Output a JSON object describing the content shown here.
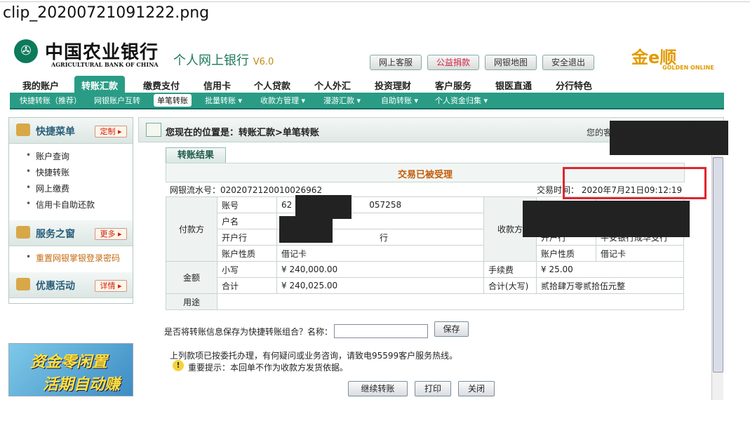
{
  "filename": "clip_20200721091222.png",
  "brand": {
    "bank_cn": "中国农业银行",
    "bank_en": "AGRICULTURAL BANK OF CHINA",
    "product": "个人网上银行",
    "version": "V6.0",
    "golden_cn": "金e顺",
    "golden_en": "GOLDEN ONLINE"
  },
  "top_buttons": [
    "网上客服",
    "公益捐款",
    "网银地图",
    "安全退出"
  ],
  "nav": [
    "我的账户",
    "转账汇款",
    "缴费支付",
    "信用卡",
    "个人贷款",
    "个人外汇",
    "投资理财",
    "客户服务",
    "银医直通",
    "分行特色"
  ],
  "subnav": [
    "快捷转账（推荐）",
    "网银账户互转",
    "单笔转账",
    "批量转账 ▾",
    "收款方管理 ▾",
    "漫游汇款 ▾",
    "自助转账 ▾",
    "个人资金归集 ▾"
  ],
  "sidebar": {
    "quick_title": "快捷菜单",
    "quick_btn": "定制 ▸",
    "quick_items": [
      "账户查询",
      "快捷转账",
      "网上缴费",
      "信用卡自助还款"
    ],
    "service_title": "服务之窗",
    "service_btn": "更多 ▸",
    "service_items": [
      "重置网银掌银登录密码"
    ],
    "promo_title": "优惠活动",
    "promo_btn": "详情 ▸",
    "banner_line1": "资金零闲置",
    "banner_line2": "活期自动赚"
  },
  "location": "您现在的位置是：转账汇款>单笔转账",
  "user_prefix": "您的客",
  "result": {
    "tab": "转账结果",
    "status": "交易已被受理",
    "serial_label": "网银流水号：",
    "serial": "0202072120010026962",
    "time_label": "交易时间：",
    "time": "2020年7月21日09:12:19",
    "payer_group": "付款方",
    "payee_group": "收款方",
    "acct_label": "账号",
    "name_label": "户名",
    "bank_label": "开户行",
    "type_label": "账户性质",
    "payer_acct_start": "62",
    "payer_acct_end": "057258",
    "payer_bank_tail": "行",
    "payer_type": "借记卡",
    "payee_bank": "平安银行成华支行",
    "payee_type": "借记卡",
    "amount_group": "金额",
    "small_label": "小写",
    "small": "¥ 240,000.00",
    "fee_label": "手续费",
    "fee": "¥ 25.00",
    "total_label": "合计",
    "total": "¥ 240,025.00",
    "total_cn_label": "合计(大写)",
    "total_cn": "贰拾肆万零贰拾伍元整",
    "purpose_label": "用途",
    "purpose": ""
  },
  "save": {
    "question": "是否将转账信息保存为快捷转账组合？名称：",
    "value": "",
    "button": "保存"
  },
  "notes": {
    "line1": "上列款项已按委托办理，有何疑问或业务咨询，请致电95599客户服务热线。",
    "line2": "重要提示：本回单不作为收款方发货依据。"
  },
  "actions": [
    "继续转账",
    "打印",
    "关闭"
  ]
}
